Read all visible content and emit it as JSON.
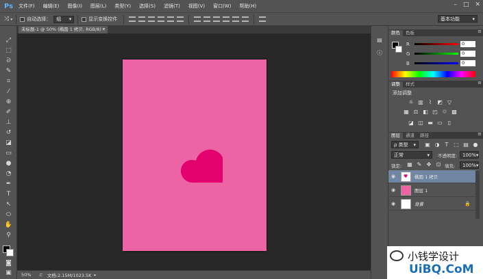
{
  "app": {
    "logo": "Ps"
  },
  "menu": [
    "文件(F)",
    "编辑(E)",
    "图像(I)",
    "图层(L)",
    "类型(Y)",
    "选择(S)",
    "滤镜(T)",
    "视图(V)",
    "窗口(W)",
    "帮助(H)"
  ],
  "window_controls": {
    "minimize": "–",
    "maximize": "□",
    "close": "✕"
  },
  "options": {
    "auto_select_label": "自动选择：",
    "auto_select_value": "组",
    "show_transform_label": "显示变换控件",
    "workspace": "基本功能"
  },
  "document": {
    "tab_title": "未标题-1 @ 50% (椭圆 1 拷贝, RGB/8) *",
    "tab_close": "×",
    "canvas_color": "#ed64a4",
    "heart_color": "#e3006f"
  },
  "status": {
    "zoom": "50%",
    "doc_info": "文档:2.15M/1023.5K"
  },
  "color_panel": {
    "tabs": [
      "颜色",
      "色板"
    ],
    "sliders": [
      {
        "label": "R",
        "value": "0"
      },
      {
        "label": "G",
        "value": "0"
      },
      {
        "label": "B",
        "value": "0"
      }
    ]
  },
  "adjust_panel": {
    "tabs": [
      "调整",
      "样式"
    ],
    "heading": "添加调整"
  },
  "layers_panel": {
    "tabs": [
      "图层",
      "通道",
      "路径"
    ],
    "filter_label": "ρ 类型",
    "blend_mode": "正常",
    "opacity_label": "不透明度:",
    "opacity": "100%",
    "lock_label": "锁定:",
    "fill_label": "填充:",
    "fill": "100%",
    "layers": [
      {
        "name": "椭圆 1 拷贝",
        "selected": true
      },
      {
        "name": "图层 1",
        "selected": false
      },
      {
        "name": "背景",
        "selected": false
      }
    ]
  },
  "watermark": {
    "line1": "小钱学设计",
    "line2": "UiBQ.CoM"
  }
}
